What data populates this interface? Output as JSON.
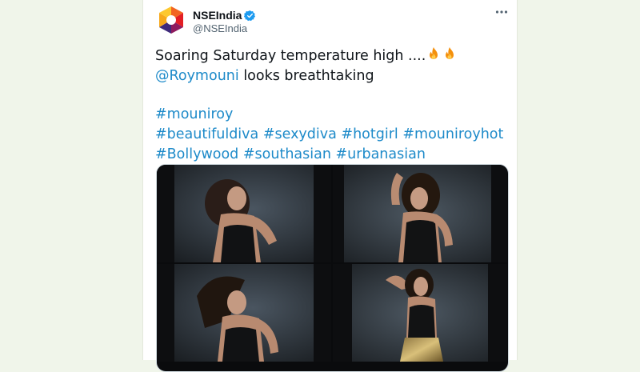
{
  "tweet": {
    "display_name": "NSEIndia",
    "handle": "@NSEIndia",
    "verified": true,
    "more_icon": "more-options-icon",
    "lines": {
      "line1": "Soaring Saturday temperature high ....",
      "fire_icons": [
        "fire-emoji-icon",
        "fire-emoji-icon"
      ],
      "mention": "@Roymouni",
      "line2_rest": " looks breathtaking",
      "hashtag_row1": [
        "#mouniroy"
      ],
      "hashtag_row2": [
        "#beautifuldiva",
        "#sexydiva",
        "#hotgirl",
        "#mouniroyhot"
      ],
      "hashtag_row3": [
        "#Bollywood",
        "#southasian",
        "#urbanasian"
      ]
    },
    "media": {
      "photo_count": 4
    }
  },
  "colors": {
    "link": "#1d8ac9",
    "verified": "#1d9bf0",
    "text": "#0f1419",
    "secondary": "#536471",
    "page_bg": "#f0f5ea"
  }
}
